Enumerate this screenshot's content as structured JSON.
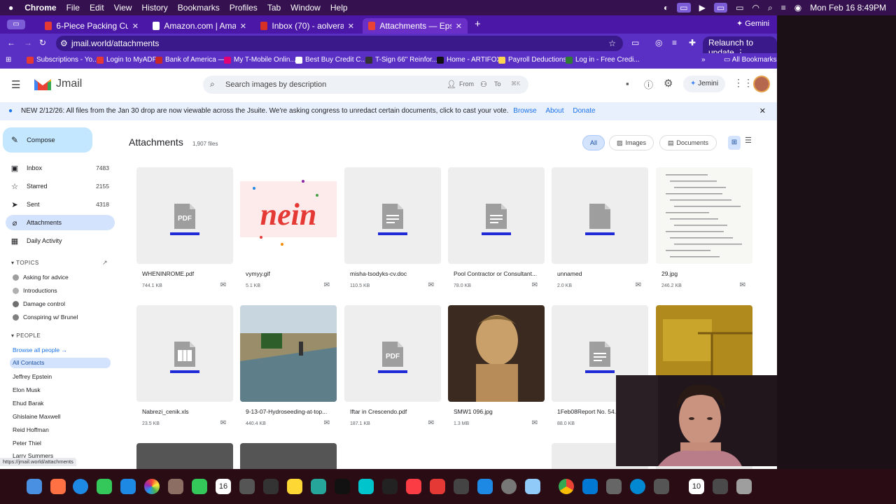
{
  "menubar": {
    "app": "Chrome",
    "items": [
      "File",
      "Edit",
      "View",
      "History",
      "Bookmarks",
      "Profiles",
      "Tab",
      "Window",
      "Help"
    ],
    "datetime": "Mon Feb 16  8:49PM"
  },
  "tabs": [
    {
      "label": "6-Piece Packing Cube Set",
      "color": "#e53935"
    },
    {
      "label": "Amazon.com | Amazon Essen",
      "color": "#ffffff"
    },
    {
      "label": "Inbox (70) - aolvera210367@",
      "color": "#d93025"
    },
    {
      "label": "Attachments — Epstein Email",
      "color": "#ea4335"
    }
  ],
  "gemini_label": "Gemini",
  "address": "jmail.world/attachments",
  "relaunch_label": "Relaunch to update",
  "bookmarks": [
    "Subscriptions - Yo...",
    "Login to MyADP",
    "Bank of America —...",
    "My T-Mobile Onlin...",
    "Best Buy Credit C...",
    "T-Sign 66\" Reinfor...",
    "Home - ARTIFOX",
    "Payroll Deductions...",
    "Log in - Free Credi..."
  ],
  "all_bookmarks": "All Bookmarks",
  "app": {
    "name": "Jmail",
    "search_placeholder": "Search images by description",
    "from_label": "From",
    "to_label": "To",
    "shortcut": "⌘K",
    "jemini_label": "Jemini"
  },
  "banner": {
    "text": "NEW 2/12/26: All files from the Jan 30 drop are now viewable across the Jsuite. We're asking congress to unredact certain documents, click  to cast your vote.",
    "browse": "Browse",
    "about": "About",
    "donate": "Donate"
  },
  "sidebar": {
    "compose": "Compose",
    "items": [
      {
        "label": "Inbox",
        "count": "7483",
        "icon": "inbox-icon",
        "glyph": "▣"
      },
      {
        "label": "Starred",
        "count": "2155",
        "icon": "star-icon",
        "glyph": "☆"
      },
      {
        "label": "Sent",
        "count": "4318",
        "icon": "send-icon",
        "glyph": "➤"
      },
      {
        "label": "Attachments",
        "count": "",
        "icon": "paperclip-icon",
        "glyph": "⌀"
      },
      {
        "label": "Daily Activity",
        "count": "",
        "icon": "calendar-icon",
        "glyph": "▦"
      }
    ],
    "topics_title": "TOPICS",
    "topics": [
      {
        "label": "Asking for advice",
        "color": "#9e9e9e"
      },
      {
        "label": "Introductions",
        "color": "#b0b0b0"
      },
      {
        "label": "Damage control",
        "color": "#707070"
      },
      {
        "label": "Conspiring w/ Brunel",
        "color": "#808080"
      }
    ],
    "people_title": "PEOPLE",
    "browse_people": "Browse all people →",
    "people": [
      "All Contacts",
      "Jeffrey Epstein",
      "Elon Musk",
      "Ehud Barak",
      "Ghislaine Maxwell",
      "Reid Hoffman",
      "Peter Thiel",
      "Larry Summers"
    ]
  },
  "main": {
    "title": "Attachments",
    "count": "1,907 files",
    "filters": [
      "All",
      "Images",
      "Documents"
    ],
    "files": [
      {
        "name": "WHENINROME.pdf",
        "size": "744.1 KB",
        "kind": "pdf"
      },
      {
        "name": "vymyy.gif",
        "size": "5.1 KB",
        "kind": "gif"
      },
      {
        "name": "misha-tsodyks-cv.doc",
        "size": "110.5 KB",
        "kind": "doc"
      },
      {
        "name": "Pool Contractor or Consultant...",
        "size": "78.0 KB",
        "kind": "doc"
      },
      {
        "name": "unnamed",
        "size": "2.0 KB",
        "kind": "file"
      },
      {
        "name": "29.jpg",
        "size": "246.2 KB",
        "kind": "scan"
      },
      {
        "name": "Nabrezi_cenik.xls",
        "size": "23.5 KB",
        "kind": "xls"
      },
      {
        "name": "9-13-07-Hydroseeding-at-top...",
        "size": "440.4 KB",
        "kind": "photo-field"
      },
      {
        "name": "Iftar in Crescendo.pdf",
        "size": "187.1 KB",
        "kind": "pdf"
      },
      {
        "name": "SMW1 096.jpg",
        "size": "1.3 MB",
        "kind": "photo-bust"
      },
      {
        "name": "1Feb08Report No. 54.d...",
        "size": "88.0 KB",
        "kind": "doc"
      },
      {
        "name": "",
        "size": "",
        "kind": "photo-gold"
      }
    ]
  },
  "status_url": "https://jmail.world/attachments",
  "dock_calendar_day": "10",
  "dock_date_badge": "16",
  "tray_badge": "2"
}
